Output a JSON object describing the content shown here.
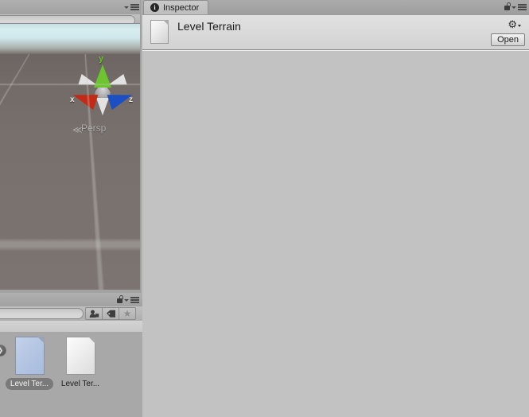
{
  "scene_view": {
    "menu_icon": "hamburger-menu-icon",
    "search_placeholder": "",
    "search_value": "",
    "gizmo": {
      "x_label": "x",
      "y_label": "y",
      "z_label": "z",
      "x_color": "#c22a15",
      "y_color": "#6cc42e",
      "z_color": "#1d4fc4",
      "projection_label": "Persp",
      "projection_arrow": "≪"
    },
    "sky_color": "#d7eef0",
    "ground_color": "#786f6c"
  },
  "project_view": {
    "menu_icon": "hamburger-menu-icon",
    "lock_icon": "lock-icon",
    "search_value": "",
    "toolbar_buttons": [
      {
        "name": "filter-by-type-button",
        "icon": "type-filter-icon",
        "label": ""
      },
      {
        "name": "filter-by-label-button",
        "icon": "tag-icon",
        "label": ""
      },
      {
        "name": "favorites-button",
        "icon": "star-icon",
        "label": "★"
      }
    ],
    "back_button_glyph": "❯",
    "assets": [
      {
        "name": "Level Ter...",
        "full_name": "Level Terrain",
        "selected": true,
        "thumb": "blue"
      },
      {
        "name": "Level Ter...",
        "full_name": "Level Terrain",
        "selected": false,
        "thumb": "white"
      }
    ]
  },
  "inspector": {
    "tab_label": "Inspector",
    "tab_icon": "info-icon",
    "tab_icon_glyph": "i",
    "lock_icon": "lock-icon",
    "menu_icon": "hamburger-menu-icon",
    "asset_name": "Level Terrain",
    "asset_icon": "file-icon",
    "gear_icon": "gear-icon",
    "gear_glyph": "⚙",
    "open_button_label": "Open",
    "body_text": ""
  },
  "colors": {
    "window_chrome": "#a8a8a8",
    "inspector_body": "#c2c2c2",
    "header_gradient_top": "#e0e0e0",
    "selected_label_bg": "#7a7a7a",
    "tab_active_bg": "#c9c9c9"
  }
}
